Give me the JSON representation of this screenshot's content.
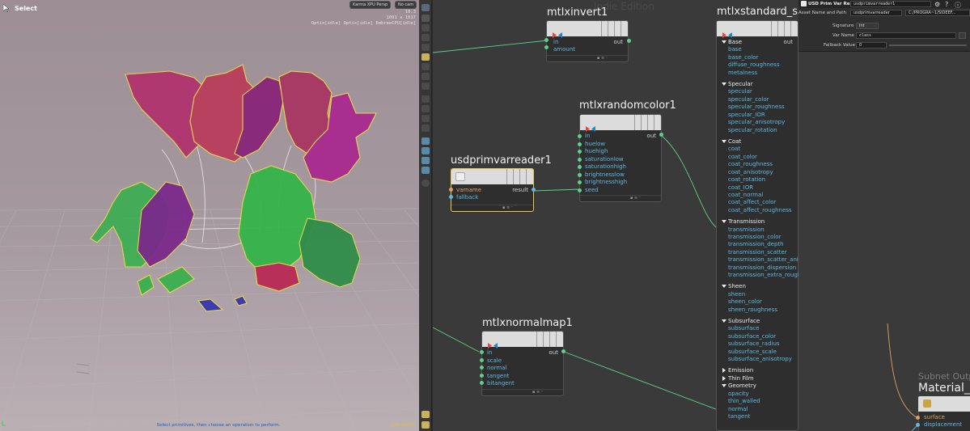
{
  "viewport": {
    "tool_label": "Select",
    "renderer_menu": "Karma XPU  Persp",
    "camera_menu": "No cam",
    "stats": [
      "10.3",
      "1091 x 1017",
      "Optix[idle] Optix[idle] EmbreeCPU[idle]"
    ],
    "status_text": "Select primitives, then choose an operation to perform.",
    "edition": "Indie Edition"
  },
  "network": {
    "watermark": "Indie Edition",
    "nodes": {
      "invert": {
        "title": "mtlxinvert1",
        "inputs": [
          "in",
          "amount"
        ],
        "output": "out"
      },
      "randomcolor": {
        "title": "mtlxrandomcolor1",
        "inputs": [
          "in",
          "huelow",
          "huehigh",
          "saturationlow",
          "saturationhigh",
          "brightnesslow",
          "brightnesshigh",
          "seed"
        ],
        "output": "out"
      },
      "primvar": {
        "title": "usdprimvarreader1",
        "inputs": [
          "varname",
          "fallback"
        ],
        "output": "result"
      },
      "normalmap": {
        "title": "mtlxnormalmap1",
        "inputs": [
          "in",
          "scale",
          "normal",
          "tangent",
          "bitangent"
        ],
        "output": "out"
      },
      "standard": {
        "title": "mtlxstandard_su",
        "output": "out",
        "groups": [
          {
            "label": "Base",
            "open": true,
            "items": [
              "base",
              "base_color",
              "diffuse_roughness",
              "metalness"
            ]
          },
          {
            "label": "Specular",
            "open": true,
            "items": [
              "specular",
              "specular_color",
              "specular_roughness",
              "specular_IOR",
              "specular_anisotropy",
              "specular_rotation"
            ]
          },
          {
            "label": "Coat",
            "open": true,
            "items": [
              "coat",
              "coat_color",
              "coat_roughness",
              "coat_anisotropy",
              "coat_rotation",
              "coat_IOR",
              "coat_normal",
              "coat_affect_color",
              "coat_affect_roughness"
            ]
          },
          {
            "label": "Transmission",
            "open": true,
            "items": [
              "transmission",
              "transmission_color",
              "transmission_depth",
              "transmission_scatter",
              "transmission_scatter_anis...",
              "transmission_dispersion",
              "transmission_extra_rough..."
            ]
          },
          {
            "label": "Sheen",
            "open": true,
            "items": [
              "sheen",
              "sheen_color",
              "sheen_roughness"
            ]
          },
          {
            "label": "Subsurface",
            "open": true,
            "items": [
              "subsurface",
              "subsurface_color",
              "subsurface_radius",
              "subsurface_scale",
              "subsurface_anisotropy"
            ]
          },
          {
            "label": "Emission",
            "open": false,
            "items": []
          },
          {
            "label": "Thin Film",
            "open": false,
            "items": []
          },
          {
            "label": "Geometry",
            "open": true,
            "items": [
              "opacity",
              "thin_walled",
              "normal",
              "tangent"
            ]
          }
        ]
      }
    },
    "subnet": {
      "title": "Subnet Outp",
      "node_name": "Material_O",
      "inputs": [
        "surface",
        "displacement"
      ]
    }
  },
  "parameters": {
    "node_type": "USD Prim Var Reader",
    "node_name": "usdprimvarreader1",
    "asset_label": "Asset Name and Path",
    "asset_value": "usdprimvarreader",
    "asset_path": "C:/PROGRA~1/SIDEEF...",
    "rows": [
      {
        "label": "Signature",
        "value": "Int"
      },
      {
        "label": "Var Name",
        "value": "class"
      },
      {
        "label": "Fallback Value",
        "value": "0"
      }
    ]
  }
}
